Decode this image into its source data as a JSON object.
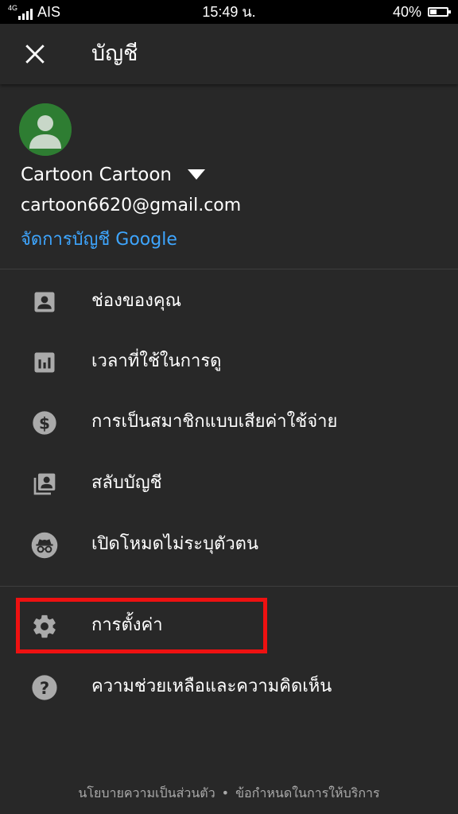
{
  "status_bar": {
    "network": "4G",
    "carrier": "AIS",
    "time": "15:49 น.",
    "battery_percent": "40%",
    "battery_level": 0.4
  },
  "app_bar": {
    "close_icon": "close-icon",
    "title": "บัญชี"
  },
  "account": {
    "name": "Cartoon Cartoon",
    "email": "cartoon6620@gmail.com",
    "manage_link": "จัดการบัญชี Google",
    "avatar_color": "#2e7d32"
  },
  "menu": {
    "items": [
      {
        "label": "ช่องของคุณ",
        "icon": "person-box-icon"
      },
      {
        "label": "เวลาที่ใช้ในการดู",
        "icon": "bar-chart-icon"
      },
      {
        "label": "การเป็นสมาชิกแบบเสียค่าใช้จ่าย",
        "icon": "dollar-circle-icon"
      },
      {
        "label": "สลับบัญชี",
        "icon": "switch-account-icon"
      },
      {
        "label": "เปิดโหมดไม่ระบุตัวตน",
        "icon": "incognito-icon"
      },
      {
        "label": "การตั้งค่า",
        "icon": "gear-icon"
      },
      {
        "label": "ความช่วยเหลือและความคิดเห็น",
        "icon": "help-icon"
      }
    ]
  },
  "footer": {
    "privacy": "นโยบายความเป็นส่วนตัว",
    "separator": "•",
    "terms": "ข้อกำหนดในการให้บริการ"
  },
  "colors": {
    "background": "#282828",
    "link": "#3ea6ff",
    "highlight": "#ee1111",
    "icon": "#aaaaaa"
  }
}
